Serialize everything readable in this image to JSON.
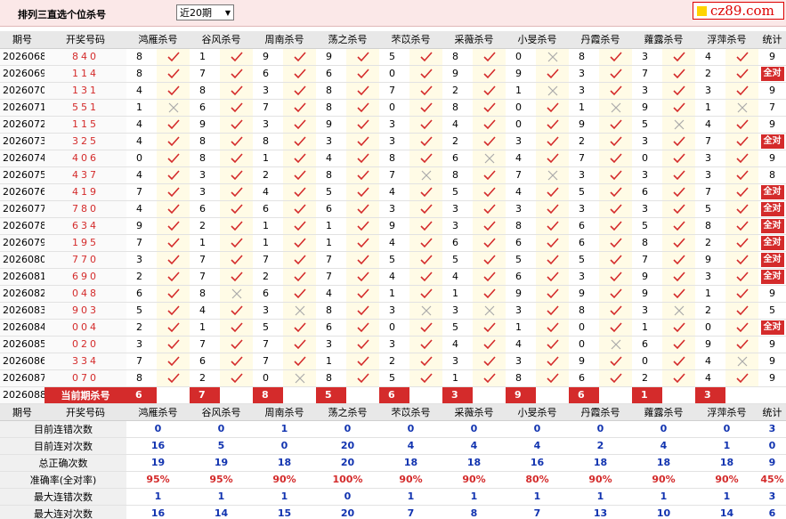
{
  "title": "排列三直选个位杀号",
  "period_select": "近20期",
  "logo_text": "cz89.com",
  "columns": [
    "期号",
    "开奖号码",
    "鸿雁杀号",
    "谷风杀号",
    "周南杀号",
    "荡之杀号",
    "芣苡杀号",
    "采薇杀号",
    "小旻杀号",
    "丹霞杀号",
    "蕹露杀号",
    "浮萍杀号",
    "统计"
  ],
  "rows": [
    {
      "period": "2026068",
      "draw": "840",
      "kills": [
        {
          "n": "8",
          "ok": true
        },
        {
          "n": "1",
          "ok": true
        },
        {
          "n": "9",
          "ok": true
        },
        {
          "n": "9",
          "ok": true
        },
        {
          "n": "5",
          "ok": true
        },
        {
          "n": "8",
          "ok": true
        },
        {
          "n": "0",
          "ok": false
        },
        {
          "n": "8",
          "ok": true
        },
        {
          "n": "3",
          "ok": true
        },
        {
          "n": "4",
          "ok": true
        }
      ],
      "stat": "9",
      "all": false
    },
    {
      "period": "2026069",
      "draw": "114",
      "kills": [
        {
          "n": "8",
          "ok": true
        },
        {
          "n": "7",
          "ok": true
        },
        {
          "n": "6",
          "ok": true
        },
        {
          "n": "6",
          "ok": true
        },
        {
          "n": "0",
          "ok": true
        },
        {
          "n": "9",
          "ok": true
        },
        {
          "n": "9",
          "ok": true
        },
        {
          "n": "3",
          "ok": true
        },
        {
          "n": "7",
          "ok": true
        },
        {
          "n": "2",
          "ok": true
        }
      ],
      "stat": "全对",
      "all": true
    },
    {
      "period": "2026070",
      "draw": "131",
      "kills": [
        {
          "n": "4",
          "ok": true
        },
        {
          "n": "8",
          "ok": true
        },
        {
          "n": "3",
          "ok": true
        },
        {
          "n": "8",
          "ok": true
        },
        {
          "n": "7",
          "ok": true
        },
        {
          "n": "2",
          "ok": true
        },
        {
          "n": "1",
          "ok": false
        },
        {
          "n": "3",
          "ok": true
        },
        {
          "n": "3",
          "ok": true
        },
        {
          "n": "3",
          "ok": true
        }
      ],
      "stat": "9",
      "all": false
    },
    {
      "period": "2026071",
      "draw": "551",
      "kills": [
        {
          "n": "1",
          "ok": false
        },
        {
          "n": "6",
          "ok": true
        },
        {
          "n": "7",
          "ok": true
        },
        {
          "n": "8",
          "ok": true
        },
        {
          "n": "0",
          "ok": true
        },
        {
          "n": "8",
          "ok": true
        },
        {
          "n": "0",
          "ok": true
        },
        {
          "n": "1",
          "ok": false
        },
        {
          "n": "9",
          "ok": true
        },
        {
          "n": "1",
          "ok": false
        }
      ],
      "stat": "7",
      "all": false
    },
    {
      "period": "2026072",
      "draw": "115",
      "kills": [
        {
          "n": "4",
          "ok": true
        },
        {
          "n": "9",
          "ok": true
        },
        {
          "n": "3",
          "ok": true
        },
        {
          "n": "9",
          "ok": true
        },
        {
          "n": "3",
          "ok": true
        },
        {
          "n": "4",
          "ok": true
        },
        {
          "n": "0",
          "ok": true
        },
        {
          "n": "9",
          "ok": true
        },
        {
          "n": "5",
          "ok": false
        },
        {
          "n": "4",
          "ok": true
        }
      ],
      "stat": "9",
      "all": false
    },
    {
      "period": "2026073",
      "draw": "325",
      "kills": [
        {
          "n": "4",
          "ok": true
        },
        {
          "n": "8",
          "ok": true
        },
        {
          "n": "8",
          "ok": true
        },
        {
          "n": "3",
          "ok": true
        },
        {
          "n": "3",
          "ok": true
        },
        {
          "n": "2",
          "ok": true
        },
        {
          "n": "3",
          "ok": true
        },
        {
          "n": "2",
          "ok": true
        },
        {
          "n": "3",
          "ok": true
        },
        {
          "n": "7",
          "ok": true
        }
      ],
      "stat": "全对",
      "all": true
    },
    {
      "period": "2026074",
      "draw": "406",
      "kills": [
        {
          "n": "0",
          "ok": true
        },
        {
          "n": "8",
          "ok": true
        },
        {
          "n": "1",
          "ok": true
        },
        {
          "n": "4",
          "ok": true
        },
        {
          "n": "8",
          "ok": true
        },
        {
          "n": "6",
          "ok": false
        },
        {
          "n": "4",
          "ok": true
        },
        {
          "n": "7",
          "ok": true
        },
        {
          "n": "0",
          "ok": true
        },
        {
          "n": "3",
          "ok": true
        }
      ],
      "stat": "9",
      "all": false
    },
    {
      "period": "2026075",
      "draw": "437",
      "kills": [
        {
          "n": "4",
          "ok": true
        },
        {
          "n": "3",
          "ok": true
        },
        {
          "n": "2",
          "ok": true
        },
        {
          "n": "8",
          "ok": true
        },
        {
          "n": "7",
          "ok": false
        },
        {
          "n": "8",
          "ok": true
        },
        {
          "n": "7",
          "ok": false
        },
        {
          "n": "3",
          "ok": true
        },
        {
          "n": "3",
          "ok": true
        },
        {
          "n": "3",
          "ok": true
        }
      ],
      "stat": "8",
      "all": false
    },
    {
      "period": "2026076",
      "draw": "419",
      "kills": [
        {
          "n": "7",
          "ok": true
        },
        {
          "n": "3",
          "ok": true
        },
        {
          "n": "4",
          "ok": true
        },
        {
          "n": "5",
          "ok": true
        },
        {
          "n": "4",
          "ok": true
        },
        {
          "n": "5",
          "ok": true
        },
        {
          "n": "4",
          "ok": true
        },
        {
          "n": "5",
          "ok": true
        },
        {
          "n": "6",
          "ok": true
        },
        {
          "n": "7",
          "ok": true
        }
      ],
      "stat": "全对",
      "all": true
    },
    {
      "period": "2026077",
      "draw": "780",
      "kills": [
        {
          "n": "4",
          "ok": true
        },
        {
          "n": "6",
          "ok": true
        },
        {
          "n": "6",
          "ok": true
        },
        {
          "n": "6",
          "ok": true
        },
        {
          "n": "3",
          "ok": true
        },
        {
          "n": "3",
          "ok": true
        },
        {
          "n": "3",
          "ok": true
        },
        {
          "n": "3",
          "ok": true
        },
        {
          "n": "3",
          "ok": true
        },
        {
          "n": "5",
          "ok": true
        }
      ],
      "stat": "全对",
      "all": true
    },
    {
      "period": "2026078",
      "draw": "634",
      "kills": [
        {
          "n": "9",
          "ok": true
        },
        {
          "n": "2",
          "ok": true
        },
        {
          "n": "1",
          "ok": true
        },
        {
          "n": "1",
          "ok": true
        },
        {
          "n": "9",
          "ok": true
        },
        {
          "n": "3",
          "ok": true
        },
        {
          "n": "8",
          "ok": true
        },
        {
          "n": "6",
          "ok": true
        },
        {
          "n": "5",
          "ok": true
        },
        {
          "n": "8",
          "ok": true
        }
      ],
      "stat": "全对",
      "all": true
    },
    {
      "period": "2026079",
      "draw": "195",
      "kills": [
        {
          "n": "7",
          "ok": true
        },
        {
          "n": "1",
          "ok": true
        },
        {
          "n": "1",
          "ok": true
        },
        {
          "n": "1",
          "ok": true
        },
        {
          "n": "4",
          "ok": true
        },
        {
          "n": "6",
          "ok": true
        },
        {
          "n": "6",
          "ok": true
        },
        {
          "n": "6",
          "ok": true
        },
        {
          "n": "8",
          "ok": true
        },
        {
          "n": "2",
          "ok": true
        }
      ],
      "stat": "全对",
      "all": true
    },
    {
      "period": "2026080",
      "draw": "770",
      "kills": [
        {
          "n": "3",
          "ok": true
        },
        {
          "n": "7",
          "ok": true
        },
        {
          "n": "7",
          "ok": true
        },
        {
          "n": "7",
          "ok": true
        },
        {
          "n": "5",
          "ok": true
        },
        {
          "n": "5",
          "ok": true
        },
        {
          "n": "5",
          "ok": true
        },
        {
          "n": "5",
          "ok": true
        },
        {
          "n": "7",
          "ok": true
        },
        {
          "n": "9",
          "ok": true
        }
      ],
      "stat": "全对",
      "all": true
    },
    {
      "period": "2026081",
      "draw": "690",
      "kills": [
        {
          "n": "2",
          "ok": true
        },
        {
          "n": "7",
          "ok": true
        },
        {
          "n": "2",
          "ok": true
        },
        {
          "n": "7",
          "ok": true
        },
        {
          "n": "4",
          "ok": true
        },
        {
          "n": "4",
          "ok": true
        },
        {
          "n": "6",
          "ok": true
        },
        {
          "n": "3",
          "ok": true
        },
        {
          "n": "9",
          "ok": true
        },
        {
          "n": "3",
          "ok": true
        }
      ],
      "stat": "全对",
      "all": true
    },
    {
      "period": "2026082",
      "draw": "048",
      "kills": [
        {
          "n": "6",
          "ok": true
        },
        {
          "n": "8",
          "ok": false
        },
        {
          "n": "6",
          "ok": true
        },
        {
          "n": "4",
          "ok": true
        },
        {
          "n": "1",
          "ok": true
        },
        {
          "n": "1",
          "ok": true
        },
        {
          "n": "9",
          "ok": true
        },
        {
          "n": "9",
          "ok": true
        },
        {
          "n": "9",
          "ok": true
        },
        {
          "n": "1",
          "ok": true
        }
      ],
      "stat": "9",
      "all": false
    },
    {
      "period": "2026083",
      "draw": "903",
      "kills": [
        {
          "n": "5",
          "ok": true
        },
        {
          "n": "4",
          "ok": true
        },
        {
          "n": "3",
          "ok": false
        },
        {
          "n": "8",
          "ok": true
        },
        {
          "n": "3",
          "ok": false
        },
        {
          "n": "3",
          "ok": false
        },
        {
          "n": "3",
          "ok": true
        },
        {
          "n": "8",
          "ok": true
        },
        {
          "n": "3",
          "ok": false
        },
        {
          "n": "2",
          "ok": true
        }
      ],
      "stat": "5",
      "all": false
    },
    {
      "period": "2026084",
      "draw": "004",
      "kills": [
        {
          "n": "2",
          "ok": true
        },
        {
          "n": "1",
          "ok": true
        },
        {
          "n": "5",
          "ok": true
        },
        {
          "n": "6",
          "ok": true
        },
        {
          "n": "0",
          "ok": true
        },
        {
          "n": "5",
          "ok": true
        },
        {
          "n": "1",
          "ok": true
        },
        {
          "n": "0",
          "ok": true
        },
        {
          "n": "1",
          "ok": true
        },
        {
          "n": "0",
          "ok": true
        }
      ],
      "stat": "全对",
      "all": true
    },
    {
      "period": "2026085",
      "draw": "020",
      "kills": [
        {
          "n": "3",
          "ok": true
        },
        {
          "n": "7",
          "ok": true
        },
        {
          "n": "7",
          "ok": true
        },
        {
          "n": "3",
          "ok": true
        },
        {
          "n": "3",
          "ok": true
        },
        {
          "n": "4",
          "ok": true
        },
        {
          "n": "4",
          "ok": true
        },
        {
          "n": "0",
          "ok": false
        },
        {
          "n": "6",
          "ok": true
        },
        {
          "n": "9",
          "ok": true
        }
      ],
      "stat": "9",
      "all": false
    },
    {
      "period": "2026086",
      "draw": "334",
      "kills": [
        {
          "n": "7",
          "ok": true
        },
        {
          "n": "6",
          "ok": true
        },
        {
          "n": "7",
          "ok": true
        },
        {
          "n": "1",
          "ok": true
        },
        {
          "n": "2",
          "ok": true
        },
        {
          "n": "3",
          "ok": true
        },
        {
          "n": "3",
          "ok": true
        },
        {
          "n": "9",
          "ok": true
        },
        {
          "n": "0",
          "ok": true
        },
        {
          "n": "4",
          "ok": false
        }
      ],
      "stat": "9",
      "all": false
    },
    {
      "period": "2026087",
      "draw": "070",
      "kills": [
        {
          "n": "8",
          "ok": true
        },
        {
          "n": "2",
          "ok": true
        },
        {
          "n": "0",
          "ok": false
        },
        {
          "n": "8",
          "ok": true
        },
        {
          "n": "5",
          "ok": true
        },
        {
          "n": "1",
          "ok": true
        },
        {
          "n": "8",
          "ok": true
        },
        {
          "n": "6",
          "ok": true
        },
        {
          "n": "2",
          "ok": true
        },
        {
          "n": "4",
          "ok": true
        }
      ],
      "stat": "9",
      "all": false
    }
  ],
  "current": {
    "period": "2026088",
    "label": "当前期杀号",
    "values": [
      "6",
      "7",
      "8",
      "5",
      "6",
      "3",
      "9",
      "6",
      "1",
      "3"
    ]
  },
  "summary": [
    {
      "label": "目前连错次数",
      "values": [
        "0",
        "0",
        "1",
        "0",
        "0",
        "0",
        "0",
        "0",
        "0",
        "0"
      ],
      "stat": "3",
      "red": false
    },
    {
      "label": "目前连对次数",
      "values": [
        "16",
        "5",
        "0",
        "20",
        "4",
        "4",
        "4",
        "2",
        "4",
        "1"
      ],
      "stat": "0",
      "red": false
    },
    {
      "label": "总正确次数",
      "values": [
        "19",
        "19",
        "18",
        "20",
        "18",
        "18",
        "16",
        "18",
        "18",
        "18"
      ],
      "stat": "9",
      "red": false
    },
    {
      "label": "准确率(全对率)",
      "values": [
        "95%",
        "95%",
        "90%",
        "100%",
        "90%",
        "90%",
        "80%",
        "90%",
        "90%",
        "90%"
      ],
      "stat": "45%",
      "red": true
    },
    {
      "label": "最大连错次数",
      "values": [
        "1",
        "1",
        "1",
        "0",
        "1",
        "1",
        "1",
        "1",
        "1",
        "1"
      ],
      "stat": "3",
      "red": false
    },
    {
      "label": "最大连对次数",
      "values": [
        "16",
        "14",
        "15",
        "20",
        "7",
        "8",
        "7",
        "13",
        "10",
        "14"
      ],
      "stat": "6",
      "red": false
    }
  ],
  "colors": {
    "accent_red": "#d42b2b",
    "blue": "#1234b0",
    "check": "#d42b2b",
    "cross": "#aaaaaa"
  }
}
